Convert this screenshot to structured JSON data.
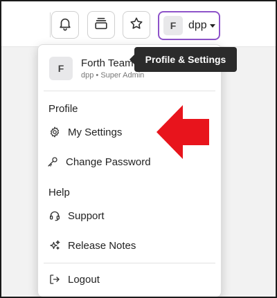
{
  "header": {
    "notifications_icon": "bell-icon",
    "inbox_icon": "stack-icon",
    "favorites_icon": "star-icon",
    "profile": {
      "avatar_initial": "F",
      "username": "dpp"
    },
    "tooltip": "Profile & Settings"
  },
  "menu": {
    "account": {
      "avatar_initial": "F",
      "team_name": "Forth Team",
      "role_line": "dpp • Super Admin"
    },
    "sections": [
      {
        "title": "Profile",
        "items": [
          {
            "label": "My Settings",
            "icon": "gear-icon"
          },
          {
            "label": "Change Password",
            "icon": "key-icon"
          }
        ]
      },
      {
        "title": "Help",
        "items": [
          {
            "label": "Support",
            "icon": "headset-icon"
          },
          {
            "label": "Release Notes",
            "icon": "sparkles-icon"
          }
        ]
      }
    ],
    "logout": {
      "label": "Logout",
      "icon": "logout-icon"
    }
  },
  "colors": {
    "accent_border": "#8d52c9",
    "tooltip_bg": "#2b2b2b",
    "annotation_arrow": "#e8141c"
  }
}
